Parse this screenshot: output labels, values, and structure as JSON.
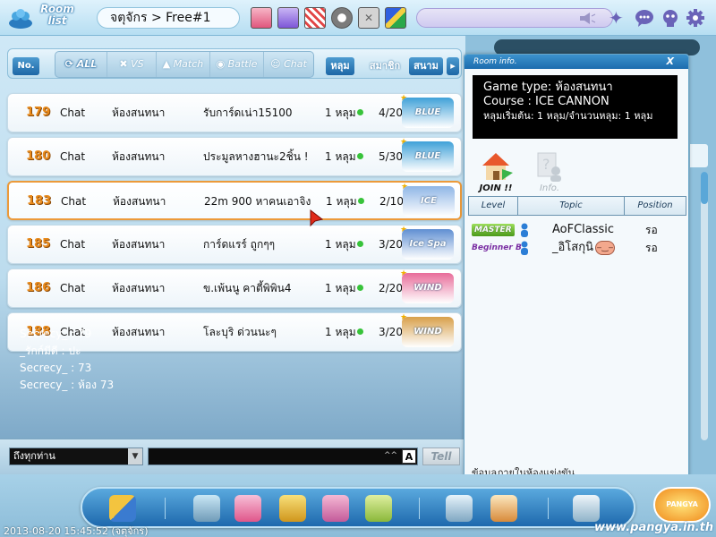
{
  "topbar": {
    "room_list_title": "Room\nlist",
    "breadcrumb": "จตุจักร > Free#1"
  },
  "filters": {
    "no_label": "No.",
    "tabs": [
      "ALL",
      "VS",
      "Match",
      "Battle",
      "Chat"
    ],
    "sort_hole": "หลุม",
    "sort_member": "สมาชิก",
    "sort_course": "สนาม"
  },
  "rooms": [
    {
      "no": "179",
      "type": "Chat",
      "mode": "ห้องสนทนา",
      "topic": "รับการ์ดเน่า15100",
      "hole": "1 หลุม",
      "count": "4/20",
      "course": "BLUE LAGOON",
      "color": "#3fa1d8"
    },
    {
      "no": "180",
      "type": "Chat",
      "mode": "ห้องสนทนา",
      "topic": "ประมูลหางฮานะ2ชิ้น !",
      "hole": "1 หลุม",
      "count": "5/30",
      "course": "BLUE LAGOON",
      "color": "#3fa1d8"
    },
    {
      "no": "183",
      "type": "Chat",
      "mode": "ห้องสนทนา",
      "topic": "22m 900 หาคนเอาจิง",
      "hole": "1 หลุม",
      "count": "2/10",
      "course": "ICE CANNON",
      "color": "#8fb6e6"
    },
    {
      "no": "185",
      "type": "Chat",
      "mode": "ห้องสนทนา",
      "topic": "การ์ดแรร์ ถูกๆๆ",
      "hole": "1 หลุม",
      "count": "3/20",
      "course": "Ice Spa",
      "color": "#5f8fd2"
    },
    {
      "no": "186",
      "type": "Chat",
      "mode": "ห้องสนทนา",
      "topic": "ข.เพ้นนู คาตี้พิพิน4",
      "hole": "1 หลุม",
      "count": "2/20",
      "course": "WIND",
      "color": "#e86c9a"
    },
    {
      "no": "188",
      "type": "Chat",
      "mode": "ห้องสนทนา",
      "topic": "โละบุริ ด่วนนะๆ",
      "hole": "1 หลุม",
      "count": "3/20",
      "course": "WIND HILL",
      "color": "#d8a04a"
    }
  ],
  "chat_log": [
    "Secrecy_ : 79",
    "_รักก์มีดี : ปะ",
    "Secrecy_ : 73",
    "Secrecy_ : ห้อง 73"
  ],
  "chat_input": {
    "channel": "ถึงทุกท่าน",
    "a_label": "A",
    "tell_label": "Tell"
  },
  "room_info": {
    "header": "Room info.",
    "close": "X",
    "game_type": "Game type: ห้องสนทนา",
    "course": "Course : ICE CANNON",
    "holes": "หลุมเริ่มต้น: 1 หลุม/จำนวนหลุม: 1 หลุม",
    "join_label": "JOIN !!",
    "info_label": "Info.",
    "columns": [
      "Level",
      "Topic",
      "Position"
    ],
    "players": [
      {
        "level": "MASTER",
        "name": "AoFClassic",
        "position": "รอ"
      },
      {
        "level": "Beginner B",
        "name": "_อิโสกุนิ",
        "position": "รอ"
      }
    ],
    "footer": "ข้อมูลภายในห้องแข่งขัน"
  },
  "status": {
    "timestamp": "2013-08-20 15:45:52 (จตุจักร)",
    "site_url": "www.pangya.in.th",
    "logo": "PANGYA"
  },
  "colors": {
    "accent": "#1d67a6",
    "room_number": "#e88a1c",
    "selected_border": "#ec9a3a",
    "online_dot": "#38c33a"
  }
}
